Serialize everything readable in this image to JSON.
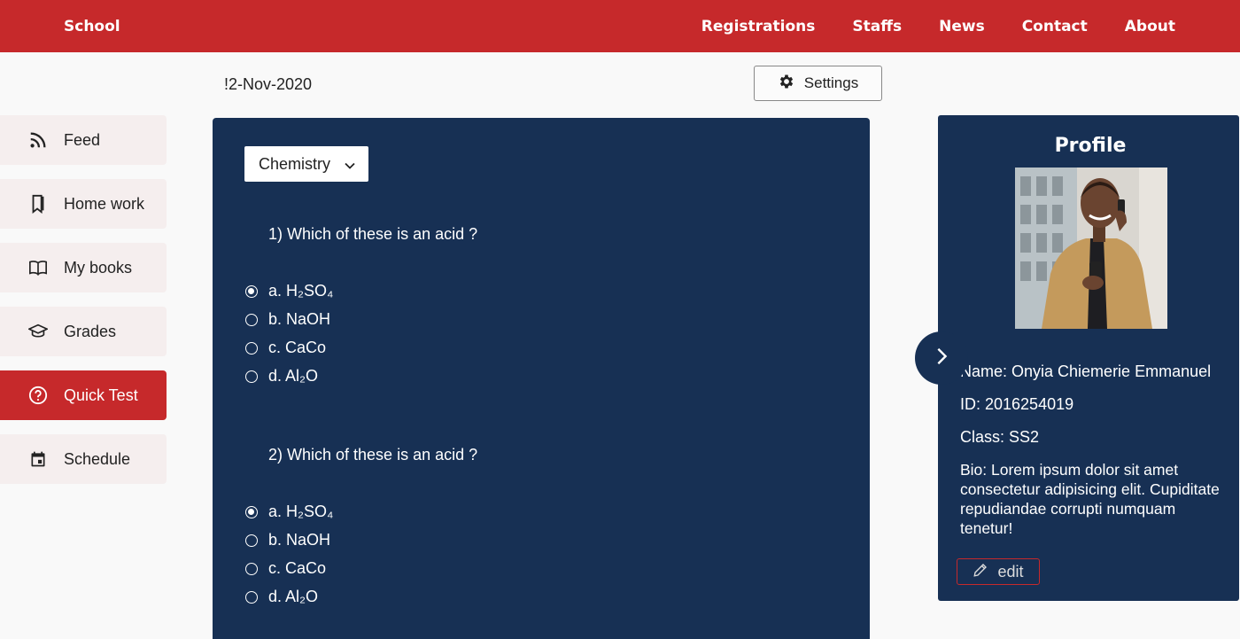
{
  "header": {
    "brand": "School",
    "nav": [
      "Registrations",
      "Staffs",
      "News",
      "Contact",
      "About"
    ]
  },
  "toolbar": {
    "date": "!2-Nov-2020",
    "settings_label": "Settings"
  },
  "sidebar": {
    "items": [
      {
        "label": "Feed",
        "icon": "rss-icon"
      },
      {
        "label": "Home work",
        "icon": "homework-icon"
      },
      {
        "label": "My books",
        "icon": "book-icon"
      },
      {
        "label": "Grades",
        "icon": "graduation-cap-icon"
      },
      {
        "label": "Quick Test",
        "icon": "question-circle-icon",
        "active": true
      },
      {
        "label": "Schedule",
        "icon": "calendar-icon"
      }
    ]
  },
  "quiz": {
    "subject": "Chemistry",
    "questions": [
      {
        "text": "1) Which of these is an acid ?",
        "options": [
          "a. H₂SO₄",
          "b. NaOH",
          "c. CaCo",
          "d. Al₂O"
        ],
        "selected": 0
      },
      {
        "text": "2) Which of these is an acid ?",
        "options": [
          "a. H₂SO₄",
          "b. NaOH",
          "c. CaCo",
          "d. Al₂O"
        ],
        "selected": 0
      }
    ]
  },
  "profile": {
    "title": "Profile",
    "name": "Name:  Onyia Chiemerie Emmanuel",
    "id": "ID:  2016254019",
    "class": "Class:  SS2",
    "bio": "Bio: Lorem ipsum dolor sit amet consectetur adipisicing elit. Cupiditate repudiandae corrupti numquam tenetur!",
    "edit_label": "edit"
  },
  "colors": {
    "accent": "#c6292b",
    "panel": "#173054"
  }
}
